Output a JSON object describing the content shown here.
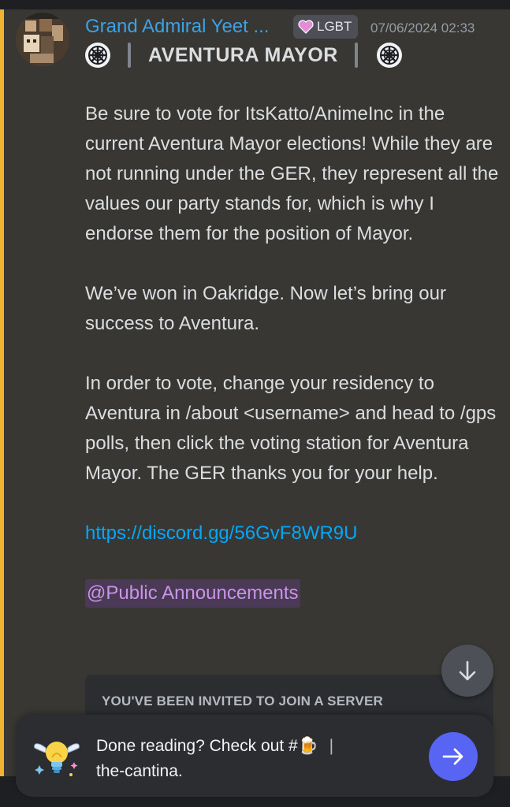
{
  "message": {
    "author": "Grand Admiral Yeet ...",
    "avatar_caption": "Yeet_Boy",
    "tag": {
      "icon": "heart-icon",
      "label": "LGBT",
      "color": "#e58cd9"
    },
    "timestamp": "07/06/2024 02:33",
    "role_title": "AVENTURA MAYOR",
    "paragraphs": [
      "Be sure to vote for ItsKatto/AnimeInc in the current Aventura Mayor elections! While they are not running under the GER, they represent all the values our party stands for, which is why I endorse them for the position of Mayor.",
      "We’ve won in Oakridge. Now let’s bring our success to Aventura.",
      "In order to vote, change your residency to Aventura in /about <username> and head to /gps polls, then click the voting station for Aventura Mayor. The GER thanks you for your help."
    ],
    "link": "https://discord.gg/56GvF8WR9U",
    "role_mention": "@Public Announcements",
    "invite_heading": "YOU'VE BEEN INVITED TO JOIN A SERVER"
  },
  "prompt": {
    "line1_prefix": "Done reading? Check out #",
    "emoji": "🍺",
    "separator": "|",
    "line2": "the-cantina."
  },
  "colors": {
    "username": "#3ba2e6",
    "link": "#00a8fc",
    "mention_highlight": "#f0b232",
    "role_mention": "#c995e6",
    "accent_button": "#5865f2"
  }
}
